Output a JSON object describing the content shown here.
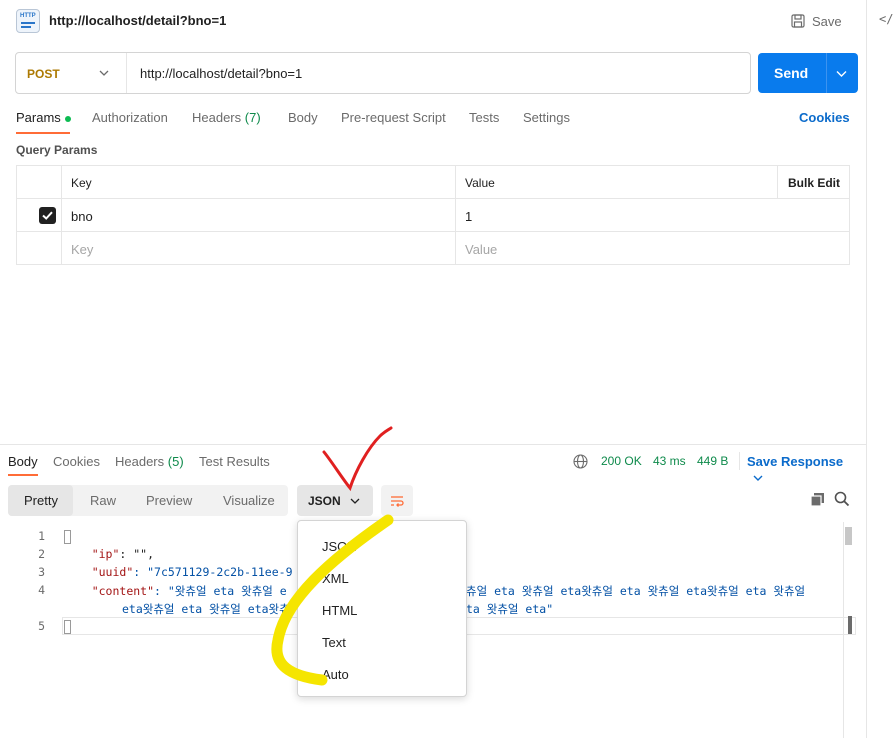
{
  "request": {
    "title": "http://localhost/detail?bno=1",
    "save_label": "Save",
    "method": "POST",
    "url": "http://localhost/detail?bno=1",
    "send_label": "Send"
  },
  "request_tabs": {
    "params": "Params",
    "authorization": "Authorization",
    "headers": "Headers",
    "headers_count": "(7)",
    "body": "Body",
    "prerequest": "Pre-request Script",
    "tests": "Tests",
    "settings": "Settings",
    "cookies": "Cookies"
  },
  "query_params": {
    "title": "Query Params",
    "col_key": "Key",
    "col_value": "Value",
    "bulk_edit": "Bulk Edit",
    "rows": [
      {
        "key": "bno",
        "value": "1",
        "checked": true
      }
    ],
    "key_placeholder": "Key",
    "value_placeholder": "Value"
  },
  "response_tabs": {
    "body": "Body",
    "cookies": "Cookies",
    "headers": "Headers",
    "headers_count": "(5)",
    "test_results": "Test Results",
    "status": "200 OK",
    "time": "43 ms",
    "size": "449 B",
    "save_response": "Save Response"
  },
  "view_modes": {
    "pretty": "Pretty",
    "raw": "Raw",
    "preview": "Preview",
    "visualize": "Visualize",
    "format": "JSON"
  },
  "editor": {
    "line_numbers": [
      "1",
      "2",
      "3",
      "4",
      "5"
    ],
    "line1": "{",
    "line2_key": "\"ip\"",
    "line2_rest": ": \"\",",
    "line3_key": "\"uuid\"",
    "line3_val": ": \"7c571129-2c2b-11ee-9",
    "line4_key": "\"content\"",
    "line4_val_a": ": \"왓츄얼 eta 왓츄얼 e",
    "line4_val_b": "츄얼 eta 왓츄얼 eta왓츄얼 eta 왓츄얼 eta왓츄얼 eta 왓츄얼",
    "line4_cont_a": "eta왓츄얼 eta 왓츄얼 eta왓츄",
    "line4_cont_b": "ta 왓츄얼 eta\"",
    "line5": "}"
  },
  "format_dropdown": {
    "options": [
      "JSON",
      "XML",
      "HTML",
      "Text",
      "Auto"
    ]
  },
  "colors": {
    "accent_orange": "#ff6c37",
    "send_blue": "#097bed",
    "link_blue": "#0b6bcb",
    "success_green": "#0e8a4b",
    "method_post": "#ad7a03",
    "annotation_red": "#e02020",
    "annotation_yellow": "#f5e500"
  }
}
